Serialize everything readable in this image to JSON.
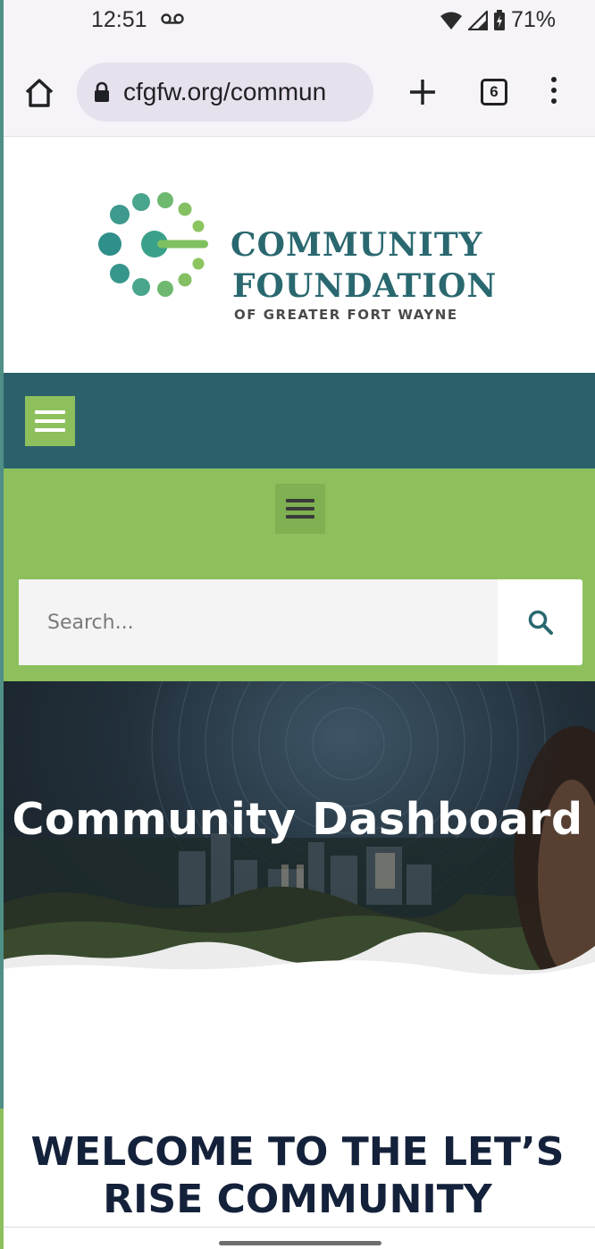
{
  "status_bar": {
    "time": "12:51",
    "battery": "71%",
    "icons": [
      "voicemail-icon",
      "wifi-icon",
      "signal-icon",
      "battery-icon"
    ]
  },
  "browser": {
    "url": "cfgfw.org/commun",
    "tab_count": "6",
    "icons": [
      "home-icon",
      "lock-icon",
      "plus-icon",
      "tabs-icon",
      "more-vert-icon"
    ]
  },
  "logo": {
    "line1": "COMMUNITY",
    "line2": "FOUNDATION",
    "line3": "OF GREATER FORT WAYNE",
    "colors": {
      "teal": "#2a6870",
      "green": "#8dc05d"
    }
  },
  "nav": {
    "teal_color": "#2a616b",
    "green_color": "#8dc05d",
    "menu_icon": "hamburger-icon"
  },
  "search": {
    "placeholder": "Search...",
    "icon": "search-icon"
  },
  "hero": {
    "title": "Community Dashboard"
  },
  "welcome": {
    "line1": "WELCOME TO THE LET’S",
    "line2": "RISE COMMUNITY"
  }
}
